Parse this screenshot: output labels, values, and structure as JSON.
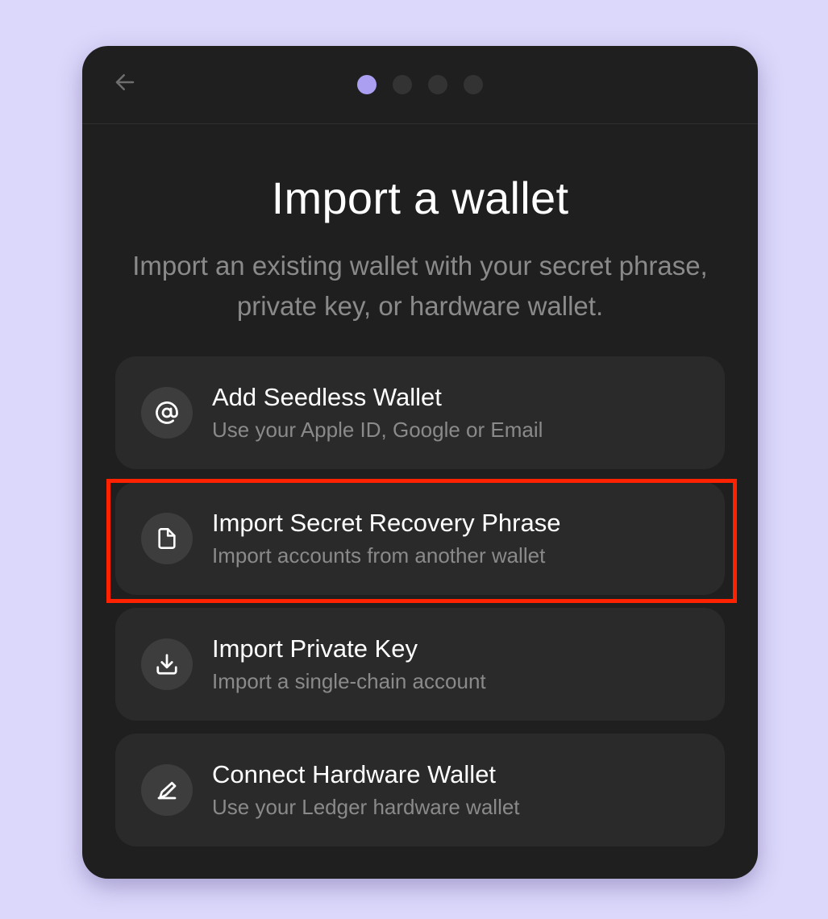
{
  "page": {
    "title": "Import a wallet",
    "subtitle": "Import an existing wallet with your secret phrase, private key, or hardware wallet."
  },
  "header": {
    "back_icon": "arrow-left-icon",
    "steps_total": 4,
    "active_step": 1
  },
  "options": [
    {
      "title": "Add Seedless Wallet",
      "subtitle": "Use your Apple ID, Google or Email",
      "icon": "at-sign-icon"
    },
    {
      "title": "Import Secret Recovery Phrase",
      "subtitle": "Import accounts from another wallet",
      "icon": "document-icon"
    },
    {
      "title": "Import Private Key",
      "subtitle": "Import a single-chain account",
      "icon": "download-icon"
    },
    {
      "title": "Connect Hardware Wallet",
      "subtitle": "Use your Ledger hardware wallet",
      "icon": "ledger-icon"
    }
  ],
  "colors": {
    "background": "#dcd8fb",
    "window": "#1f1f1f",
    "card": "#2a2a2a",
    "accent": "#ab9ff2",
    "highlight": "#ff2200"
  }
}
